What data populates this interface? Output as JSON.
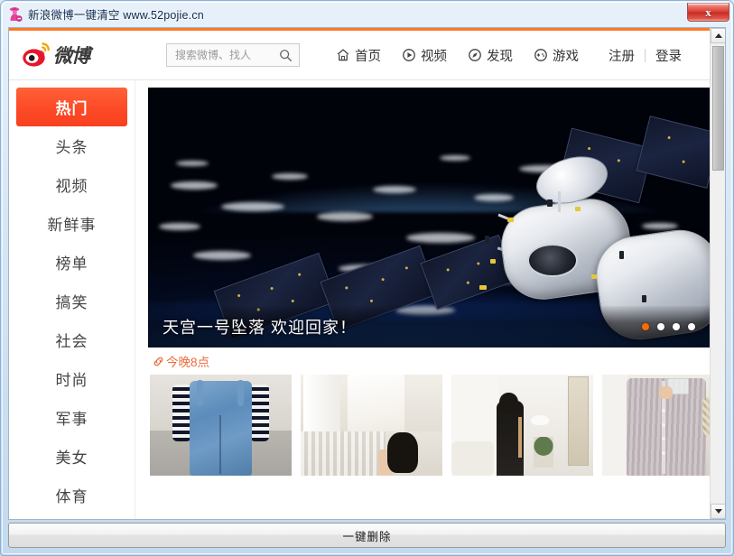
{
  "window": {
    "title": "新浪微博一键清空 www.52pojie.cn",
    "icon": "app-icon",
    "close_label": "x"
  },
  "site": {
    "logo_text": "微博",
    "accent_color": "#fb7927"
  },
  "search": {
    "placeholder": "搜索微博、找人",
    "value": "",
    "icon": "search-icon"
  },
  "nav": {
    "items": [
      {
        "label": "首页",
        "icon": "home-icon"
      },
      {
        "label": "视频",
        "icon": "play-circle-icon"
      },
      {
        "label": "发现",
        "icon": "compass-icon"
      },
      {
        "label": "游戏",
        "icon": "gamepad-icon"
      }
    ],
    "register_label": "注册",
    "login_label": "登录"
  },
  "sidebar": {
    "items": [
      {
        "label": "热门",
        "active": true
      },
      {
        "label": "头条",
        "active": false
      },
      {
        "label": "视频",
        "active": false
      },
      {
        "label": "新鲜事",
        "active": false
      },
      {
        "label": "榜单",
        "active": false
      },
      {
        "label": "搞笑",
        "active": false
      },
      {
        "label": "社会",
        "active": false
      },
      {
        "label": "时尚",
        "active": false
      },
      {
        "label": "军事",
        "active": false
      },
      {
        "label": "美女",
        "active": false
      },
      {
        "label": "体育",
        "active": false
      }
    ],
    "active_bg": "#fc4a27"
  },
  "banner": {
    "caption": "天宫一号坠落 欢迎回家！",
    "dots": [
      {
        "active": true
      },
      {
        "active": false
      },
      {
        "active": false
      },
      {
        "active": false
      }
    ]
  },
  "tag": {
    "icon": "link-icon",
    "label": "今晚8点",
    "color": "#eb6c3f"
  },
  "thumbnails": [
    {
      "name": "denim-overalls-photo"
    },
    {
      "name": "white-dress-photo"
    },
    {
      "name": "black-dress-room-photo"
    },
    {
      "name": "striped-shirt-dress-photo"
    }
  ],
  "footer": {
    "delete_all_label": "一键删除"
  },
  "scrollbar": {
    "up_arrow": "scroll-up-arrow",
    "down_arrow": "scroll-down-arrow"
  }
}
